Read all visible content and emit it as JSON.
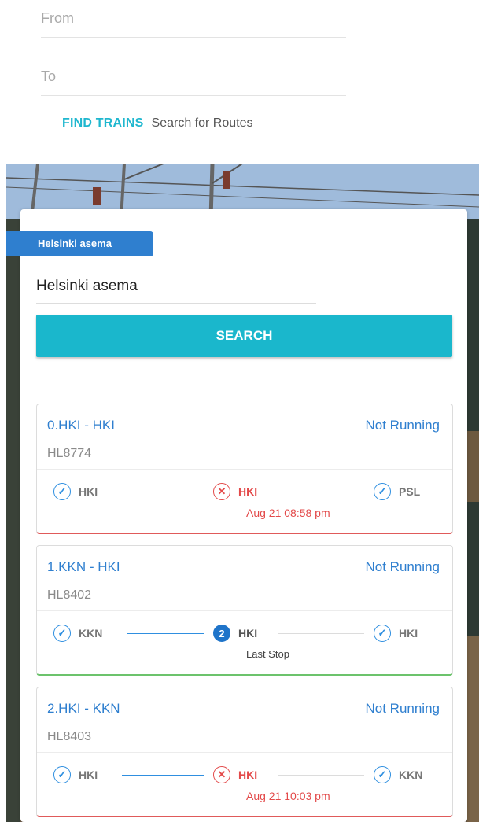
{
  "top_form": {
    "from_placeholder": "From",
    "to_placeholder": "To",
    "find_trains_label": "FIND TRAINS",
    "search_routes_label": "Search for Routes"
  },
  "station_card": {
    "tag_label": "Helsinki asema",
    "station_value": "Helsinki asema",
    "search_label": "SEARCH"
  },
  "trains": [
    {
      "route": "0.HKI - HKI",
      "status": "Not Running",
      "code": "HL8774",
      "stops": [
        {
          "label": "HKI",
          "icon": "check-circle-icon"
        },
        {
          "label": "HKI",
          "icon": "x-circle-icon",
          "sub": "Aug 21 08:58 pm"
        },
        {
          "label": "PSL",
          "icon": "check-circle-icon"
        }
      ]
    },
    {
      "route": "1.KKN - HKI",
      "status": "Not Running",
      "code": "HL8402",
      "stops": [
        {
          "label": "KKN",
          "icon": "check-circle-icon"
        },
        {
          "label": "HKI",
          "icon": "number-badge-icon",
          "badge": "2",
          "sub": "Last Stop"
        },
        {
          "label": "HKI",
          "icon": "check-circle-icon"
        }
      ]
    },
    {
      "route": "2.HKI - KKN",
      "status": "Not Running",
      "code": "HL8403",
      "stops": [
        {
          "label": "HKI",
          "icon": "check-circle-icon"
        },
        {
          "label": "HKI",
          "icon": "x-circle-icon",
          "sub": "Aug 21 10:03 pm"
        },
        {
          "label": "KKN",
          "icon": "check-circle-icon"
        }
      ]
    }
  ],
  "colors": {
    "accent": "#1ab7cc",
    "link_blue": "#2f7fcf",
    "error_red": "#e34a4a",
    "ok_green": "#6cc36c"
  }
}
